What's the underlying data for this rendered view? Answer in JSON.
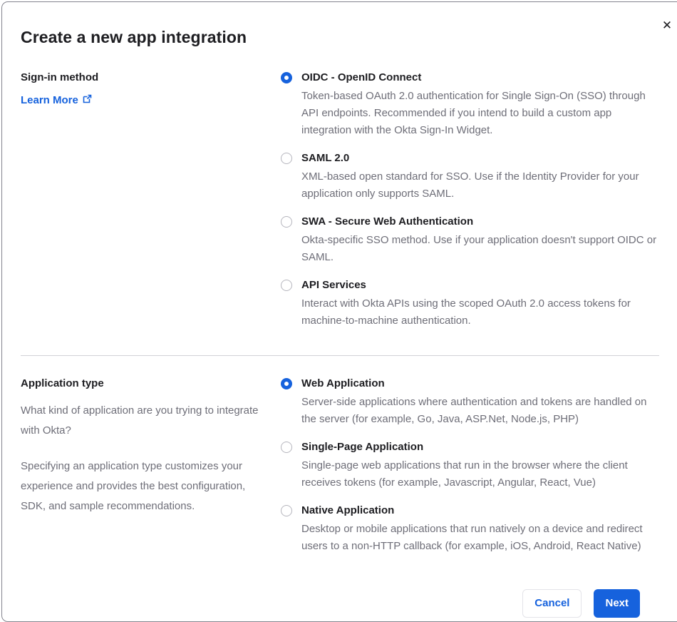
{
  "modal": {
    "title": "Create a new app integration",
    "close_glyph": "✕"
  },
  "signin": {
    "heading": "Sign-in method",
    "learn_more_label": "Learn More",
    "options": [
      {
        "label": "OIDC - OpenID Connect",
        "description": "Token-based OAuth 2.0 authentication for Single Sign-On (SSO) through API endpoints. Recommended if you intend to build a custom app integration with the Okta Sign-In Widget.",
        "selected": true
      },
      {
        "label": "SAML 2.0",
        "description": "XML-based open standard for SSO. Use if the Identity Provider for your application only supports SAML.",
        "selected": false
      },
      {
        "label": "SWA - Secure Web Authentication",
        "description": "Okta-specific SSO method. Use if your application doesn't support OIDC or SAML.",
        "selected": false
      },
      {
        "label": "API Services",
        "description": "Interact with Okta APIs using the scoped OAuth 2.0 access tokens for machine-to-machine authentication.",
        "selected": false
      }
    ]
  },
  "apptype": {
    "heading": "Application type",
    "description_1": "What kind of application are you trying to integrate with Okta?",
    "description_2": "Specifying an application type customizes your experience and provides the best configuration, SDK, and sample recommendations.",
    "options": [
      {
        "label": "Web Application",
        "description": "Server-side applications where authentication and tokens are handled on the server (for example, Go, Java, ASP.Net, Node.js, PHP)",
        "selected": true
      },
      {
        "label": "Single-Page Application",
        "description": "Single-page web applications that run in the browser where the client receives tokens (for example, Javascript, Angular, React, Vue)",
        "selected": false
      },
      {
        "label": "Native Application",
        "description": "Desktop or mobile applications that run natively on a device and redirect users to a non-HTTP callback (for example, iOS, Android, React Native)",
        "selected": false
      }
    ]
  },
  "footer": {
    "cancel_label": "Cancel",
    "next_label": "Next"
  },
  "colors": {
    "accent_blue": "#1662dd",
    "text_dark": "#1d1d21",
    "text_gray": "#6e6e78",
    "divider_gray": "#d2d2d7"
  }
}
